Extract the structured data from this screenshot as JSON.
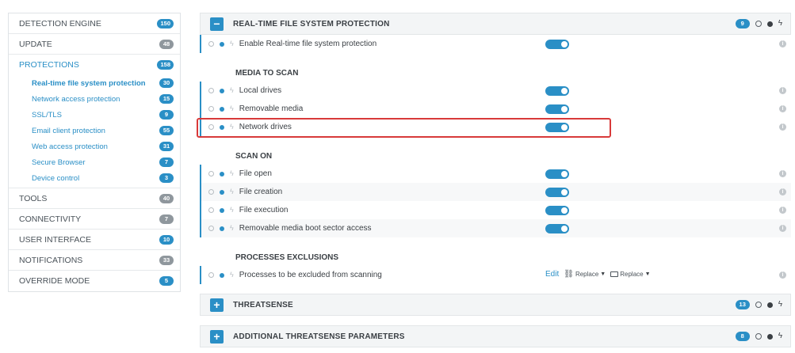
{
  "sidebar": {
    "items_before": [
      {
        "label": "DETECTION ENGINE",
        "count": "150"
      },
      {
        "label": "UPDATE",
        "count": "48"
      }
    ],
    "active": {
      "label": "PROTECTIONS",
      "count": "158"
    },
    "subitems": [
      {
        "label": "Real-time file system protection",
        "count": "30"
      },
      {
        "label": "Network access protection",
        "count": "15"
      },
      {
        "label": "SSL/TLS",
        "count": "9"
      },
      {
        "label": "Email client protection",
        "count": "55"
      },
      {
        "label": "Web access protection",
        "count": "31"
      },
      {
        "label": "Secure Browser",
        "count": "7"
      },
      {
        "label": "Device control",
        "count": "3"
      }
    ],
    "items_after": [
      {
        "label": "TOOLS",
        "count": "40"
      },
      {
        "label": "CONNECTIVITY",
        "count": "7"
      },
      {
        "label": "USER INTERFACE",
        "count": "10"
      },
      {
        "label": "NOTIFICATIONS",
        "count": "33"
      },
      {
        "label": "OVERRIDE MODE",
        "count": "5"
      }
    ]
  },
  "main": {
    "section": {
      "title": "REAL-TIME FILE SYSTEM PROTECTION",
      "count": "9",
      "toggle": "−"
    },
    "enable_row": {
      "label": "Enable Real-time file system protection"
    },
    "media_heading": "MEDIA TO SCAN",
    "media_rows": [
      {
        "label": "Local drives"
      },
      {
        "label": "Removable media"
      },
      {
        "label": "Network drives"
      }
    ],
    "scan_heading": "SCAN ON",
    "scan_rows": [
      {
        "label": "File open"
      },
      {
        "label": "File creation"
      },
      {
        "label": "File execution"
      },
      {
        "label": "Removable media boot sector access"
      }
    ],
    "exclusions_heading": "PROCESSES EXCLUSIONS",
    "exclusions_row": {
      "label": "Processes to be excluded from scanning",
      "edit": "Edit",
      "replace1": "Replace",
      "replace2": "Replace"
    },
    "collapsed_sections": [
      {
        "title": "THREATSENSE",
        "count": "13",
        "toggle": "+"
      },
      {
        "title": "ADDITIONAL THREATSENSE PARAMETERS",
        "count": "8",
        "toggle": "+"
      }
    ]
  },
  "icons": {
    "info": "i",
    "bolt": "ϟ",
    "caret": "▼",
    "network": "⛓"
  },
  "colors": {
    "accent": "#2a8fc6",
    "highlight": "#d83a3a"
  }
}
